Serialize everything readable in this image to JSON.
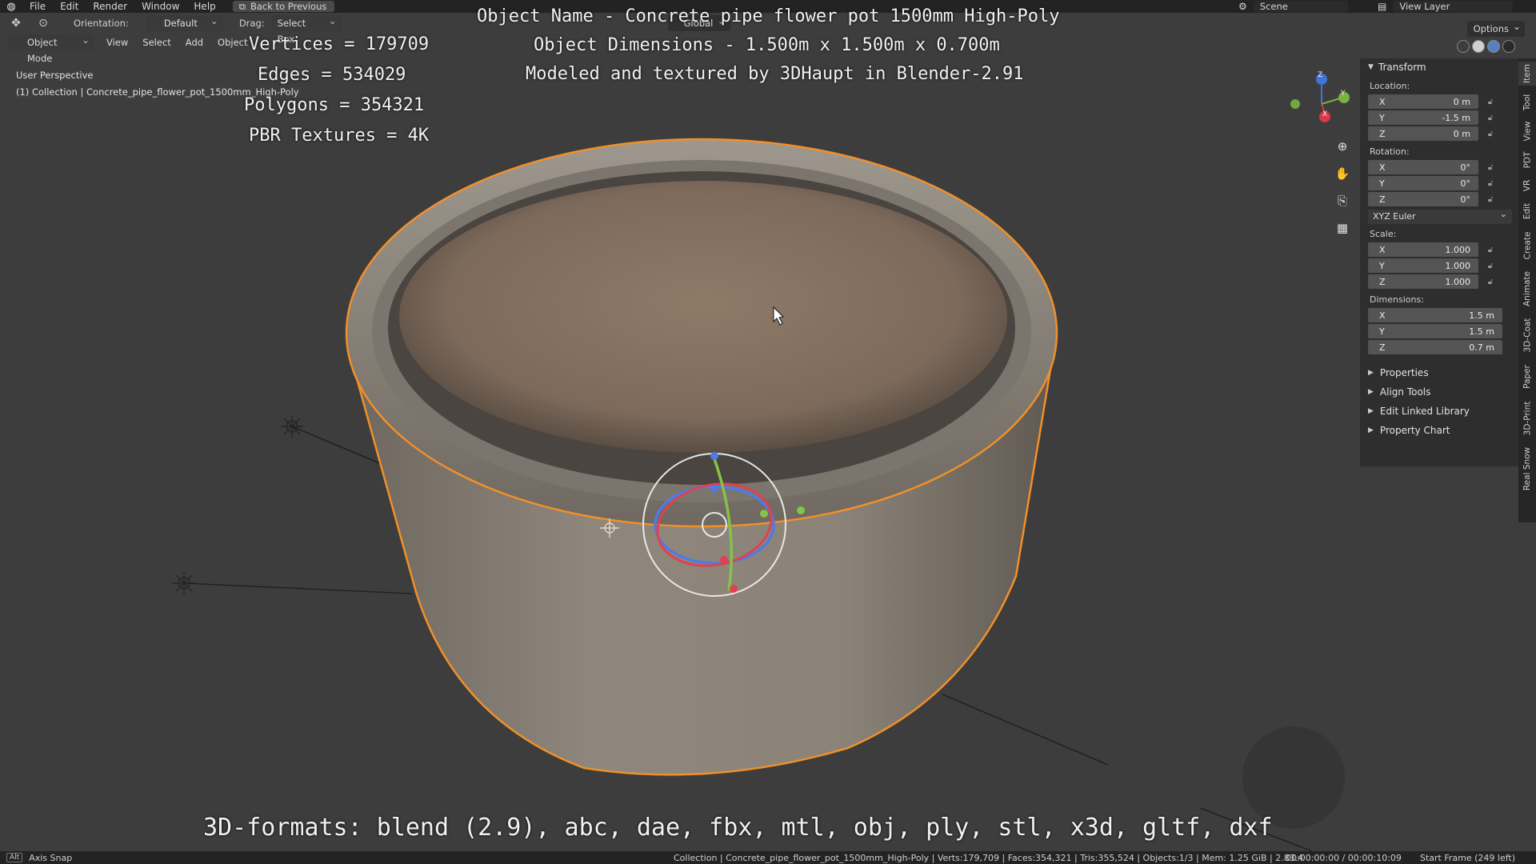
{
  "topbar": {
    "menus": [
      "File",
      "Edit",
      "Render",
      "Window",
      "Help"
    ],
    "back_button": "Back to Previous",
    "scene": "Scene",
    "view_layer": "View Layer"
  },
  "header": {
    "orientation_label": "Orientation:",
    "orientation_value": "Default",
    "drag_label": "Drag:",
    "drag_value": "Select Box",
    "transform_space": "Global",
    "mode": "Object Mode",
    "view_menu": [
      "View",
      "Select",
      "Add",
      "Object"
    ],
    "options": "Options"
  },
  "viewport": {
    "perspective": "User Perspective",
    "collection": "(1) Collection | Concrete_pipe_flower_pot_1500mm_High-Poly"
  },
  "overlay": {
    "object_name": "Object Name - Concrete pipe flower pot 1500mm High-Poly",
    "dimensions": "Object Dimensions -  1.500m x 1.500m x 0.700m",
    "credit": "Modeled and textured by 3DHaupt in Blender-2.91",
    "vertices": "Vertices = 179709",
    "edges": "Edges = 534029",
    "polygons": "Polygons = 354321",
    "textures": "PBR Textures = 4K",
    "formats": "3D-formats: blend (2.9), abc, dae, fbx, mtl, obj, ply, stl, x3d, gltf, dxf"
  },
  "npanel": {
    "transform_title": "Transform",
    "location_label": "Location:",
    "location": [
      {
        "axis": "X",
        "value": "0 m"
      },
      {
        "axis": "Y",
        "value": "-1.5 m"
      },
      {
        "axis": "Z",
        "value": "0 m"
      }
    ],
    "rotation_label": "Rotation:",
    "rotation": [
      {
        "axis": "X",
        "value": "0°"
      },
      {
        "axis": "Y",
        "value": "0°"
      },
      {
        "axis": "Z",
        "value": "0°"
      }
    ],
    "rotation_mode": "XYZ Euler",
    "scale_label": "Scale:",
    "scale": [
      {
        "axis": "X",
        "value": "1.000"
      },
      {
        "axis": "Y",
        "value": "1.000"
      },
      {
        "axis": "Z",
        "value": "1.000"
      }
    ],
    "dimensions_label": "Dimensions:",
    "dimensions": [
      {
        "axis": "X",
        "value": "1.5 m"
      },
      {
        "axis": "Y",
        "value": "1.5 m"
      },
      {
        "axis": "Z",
        "value": "0.7 m"
      }
    ],
    "collapsed_panels": [
      "Properties",
      "Align Tools",
      "Edit Linked Library",
      "Property Chart"
    ]
  },
  "tabs": [
    "Item",
    "Tool",
    "View",
    "PDT",
    "VR",
    "Edit",
    "Create",
    "Animate",
    "3D-Coat",
    "Paper",
    "3D-Print",
    "Real Snow"
  ],
  "gizmo_axes": {
    "x": "X",
    "y": "Y",
    "z": "Z"
  },
  "statusbar": {
    "key": "Alt",
    "axis_snap": "Axis Snap",
    "info": "Collection | Concrete_pipe_flower_pot_1500mm_High-Poly | Verts:179,709 | Faces:354,321 | Tris:355,524 | Objects:1/3 | Mem: 1.25 GiB | 2.83.4",
    "time": "00:00:00:00 / 00:00:10:09",
    "frame": "Start Frame (249 left)"
  },
  "colors": {
    "selection_outline": "#f0902a",
    "soil": "#8a7462",
    "concrete": "#8c8378",
    "background": "#3d3d3d"
  }
}
